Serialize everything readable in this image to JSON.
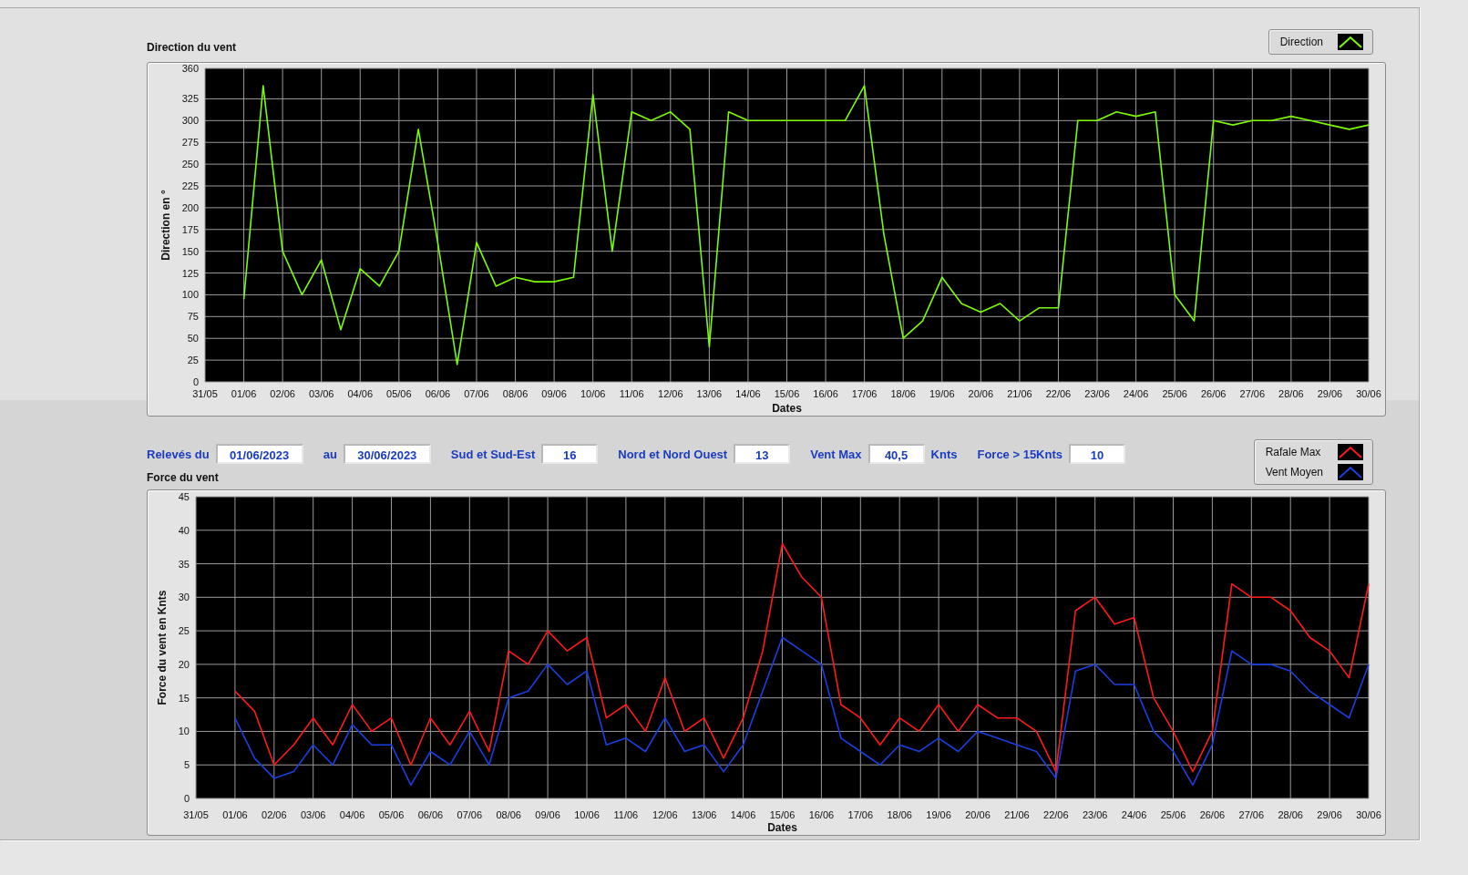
{
  "direction_chart": {
    "chart_data": {
      "type": "line",
      "grid": true,
      "title": "Direction du vent",
      "xlabel": "Dates",
      "ylabel": "Direction en °",
      "ylim": [
        0,
        360
      ],
      "yticks": [
        0,
        25,
        50,
        75,
        100,
        125,
        150,
        175,
        200,
        225,
        250,
        275,
        300,
        325,
        360
      ],
      "categories": [
        "31/05",
        null,
        "01/06",
        null,
        "02/06",
        null,
        "03/06",
        null,
        "04/06",
        null,
        "05/06",
        null,
        "06/06",
        null,
        "07/06",
        null,
        "08/06",
        null,
        "09/06",
        null,
        "10/06",
        null,
        "11/06",
        null,
        "12/06",
        null,
        "13/06",
        null,
        "14/06",
        null,
        "15/06",
        null,
        "16/06",
        null,
        "17/06",
        null,
        "18/06",
        null,
        "19/06",
        null,
        "20/06",
        null,
        "21/06",
        null,
        "22/06",
        null,
        "23/06",
        null,
        "24/06",
        null,
        "25/06",
        null,
        "26/06",
        null,
        "27/06",
        null,
        "28/06",
        null,
        "29/06",
        null,
        "30/06"
      ],
      "series": [
        {
          "name": "Direction",
          "color": "#7cfc00",
          "values": [
            null,
            null,
            95,
            340,
            150,
            100,
            140,
            60,
            130,
            110,
            150,
            290,
            160,
            20,
            160,
            110,
            120,
            115,
            115,
            120,
            330,
            150,
            310,
            300,
            310,
            290,
            40,
            310,
            300,
            300,
            300,
            300,
            300,
            300,
            340,
            170,
            50,
            70,
            120,
            90,
            80,
            90,
            70,
            85,
            85,
            300,
            300,
            310,
            305,
            310,
            100,
            70,
            300,
            295,
            300,
            300,
            305,
            300,
            295,
            290,
            295
          ]
        }
      ]
    }
  },
  "filters": [
    {
      "label": "Relevés du",
      "value": "01/06/2023"
    },
    {
      "label": "au",
      "value": "30/06/2023"
    },
    {
      "label": "Sud et Sud-Est",
      "value": "16"
    },
    {
      "label": "Nord et Nord Ouest",
      "value": "13"
    },
    {
      "label": "Vent Max",
      "value": "40,5",
      "unit": "Knts"
    },
    {
      "label": "Force > 15Knts",
      "value": "10"
    }
  ],
  "force_chart": {
    "chart_data": {
      "type": "line",
      "grid": true,
      "title": "Force du vent",
      "xlabel": "Dates",
      "ylabel": "Force du vent en Knts",
      "ylim": [
        0,
        45
      ],
      "yticks": [
        0,
        5,
        10,
        15,
        20,
        25,
        30,
        35,
        40,
        45
      ],
      "categories": [
        "31/05",
        null,
        "01/06",
        null,
        "02/06",
        null,
        "03/06",
        null,
        "04/06",
        null,
        "05/06",
        null,
        "06/06",
        null,
        "07/06",
        null,
        "08/06",
        null,
        "09/06",
        null,
        "10/06",
        null,
        "11/06",
        null,
        "12/06",
        null,
        "13/06",
        null,
        "14/06",
        null,
        "15/06",
        null,
        "16/06",
        null,
        "17/06",
        null,
        "18/06",
        null,
        "19/06",
        null,
        "20/06",
        null,
        "21/06",
        null,
        "22/06",
        null,
        "23/06",
        null,
        "24/06",
        null,
        "25/06",
        null,
        "26/06",
        null,
        "27/06",
        null,
        "28/06",
        null,
        "29/06",
        null,
        "30/06"
      ],
      "series": [
        {
          "name": "Rafale Max",
          "color": "#ff1a1a",
          "values": [
            null,
            null,
            16,
            13,
            5,
            8,
            12,
            8,
            14,
            10,
            12,
            5,
            12,
            8,
            13,
            7,
            22,
            20,
            25,
            22,
            24,
            12,
            14,
            10,
            18,
            10,
            12,
            6,
            12,
            22,
            38,
            33,
            30,
            14,
            12,
            8,
            12,
            10,
            14,
            10,
            14,
            12,
            12,
            10,
            4,
            28,
            30,
            26,
            27,
            15,
            10,
            4,
            10,
            32,
            30,
            30,
            28,
            24,
            22,
            18,
            32
          ]
        },
        {
          "name": "Vent Moyen",
          "color": "#1a3fe0",
          "values": [
            null,
            null,
            12,
            6,
            3,
            4,
            8,
            5,
            11,
            8,
            8,
            2,
            7,
            5,
            10,
            5,
            15,
            16,
            20,
            17,
            19,
            8,
            9,
            7,
            12,
            7,
            8,
            4,
            8,
            16,
            24,
            22,
            20,
            9,
            7,
            5,
            8,
            7,
            9,
            7,
            10,
            9,
            8,
            7,
            3,
            19,
            20,
            17,
            17,
            10,
            7,
            2,
            8,
            22,
            20,
            20,
            19,
            16,
            14,
            12,
            20
          ]
        }
      ]
    }
  }
}
